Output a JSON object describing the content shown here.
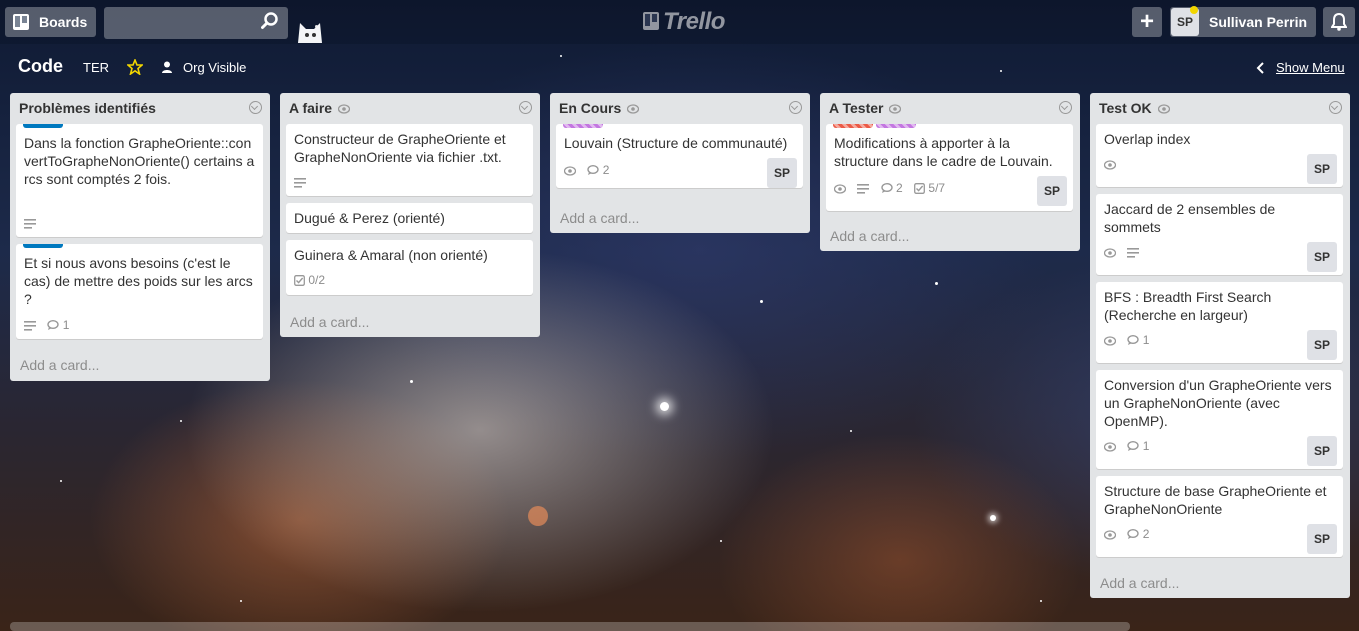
{
  "header": {
    "boards_label": "Boards",
    "search_value": "",
    "logo_text": "Trello",
    "add_label": "+",
    "member_initials": "SP",
    "member_name": "Sullivan Perrin"
  },
  "board": {
    "title": "Code",
    "org": "TER",
    "visibility": "Org Visible",
    "show_menu": "Show Menu"
  },
  "colors": {
    "label_blue": "#0079bf",
    "label_purple": "#c377e0",
    "label_red": "#eb5a46",
    "star": "#f2d600"
  },
  "lists": [
    {
      "title": "Problèmes identifiés",
      "add_card": "Add a card...",
      "cards": [
        {
          "text": "Dans la fonction GrapheOriente::convertToGrapheNonOriente() certains arcs sont comptés 2 fois.",
          "label": "blue"
        },
        {
          "text": "Et si nous avons besoins (c'est le cas) de mettre des poids sur les arcs ?",
          "label": "blue",
          "comments": "1"
        }
      ]
    },
    {
      "title": "A faire",
      "add_card": "Add a card...",
      "cards": [
        {
          "text": "Constructeur de GrapheOriente et GrapheNonOriente via fichier .txt."
        },
        {
          "text": "Dugué & Perez (orienté)"
        },
        {
          "text": "Guinera & Amaral (non orienté)",
          "checklist": "0/2"
        }
      ]
    },
    {
      "title": "En Cours",
      "add_card": "Add a card...",
      "cards": [
        {
          "text": "Louvain (Structure de communauté)",
          "comments": "2",
          "member": "SP"
        }
      ]
    },
    {
      "title": "A Tester",
      "add_card": "Add a card...",
      "cards": [
        {
          "text": "Modifications à apporter à la structure dans le cadre de Louvain.",
          "comments": "2",
          "checklist": "5/7",
          "member": "SP"
        }
      ]
    },
    {
      "title": "Test OK",
      "add_card": "Add a card...",
      "cards": [
        {
          "text": "Overlap index",
          "member": "SP"
        },
        {
          "text": "Jaccard de 2 ensembles de sommets",
          "member": "SP"
        },
        {
          "text": "BFS : Breadth First Search (Recherche en largeur)",
          "comments": "1",
          "member": "SP"
        },
        {
          "text": "Conversion d'un GrapheOriente vers un GrapheNonOriente (avec OpenMP).",
          "comments": "1",
          "member": "SP"
        },
        {
          "text": "Structure de base GrapheOriente et GrapheNonOriente",
          "comments": "2",
          "member": "SP"
        }
      ]
    }
  ]
}
